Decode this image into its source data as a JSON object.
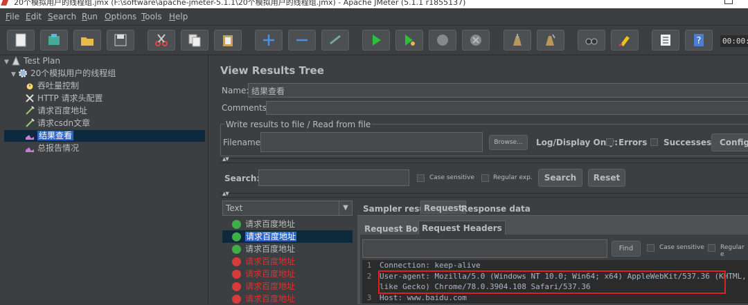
{
  "window": {
    "title": "20个模拟用户的线程组.jmx (F:\\software\\apache-jmeter-5.1.1\\20个模拟用户的线程组.jmx) - Apache JMeter (5.1.1 r1855137)"
  },
  "menu": [
    {
      "label": "File",
      "key": "F",
      "rest": "ile"
    },
    {
      "label": "Edit",
      "key": "E",
      "rest": "dit"
    },
    {
      "label": "Search",
      "key": "S",
      "rest": "earch"
    },
    {
      "label": "Run",
      "key": "R",
      "rest": "un"
    },
    {
      "label": "Options",
      "key": "O",
      "rest": "ptions"
    },
    {
      "label": "Tools",
      "key": "T",
      "rest": "ools"
    },
    {
      "label": "Help",
      "key": "H",
      "rest": "elp"
    }
  ],
  "toolbar": {
    "timer": "00:00:0",
    "icons": [
      "new-icon",
      "templates-icon",
      "open-icon",
      "save-icon",
      "cut-icon",
      "copy-icon",
      "paste-icon",
      "expand-icon",
      "collapse-icon",
      "toggle-icon",
      "start-icon",
      "start-no-pauses-icon",
      "stop-icon",
      "shutdown-icon",
      "clear-icon",
      "clear-all-icon",
      "search-icon",
      "reset-search-icon",
      "function-helper-icon",
      "help-icon"
    ]
  },
  "tree": [
    {
      "label": "Test Plan",
      "icon": "test-plan-icon",
      "level": 0,
      "arrow": "▼"
    },
    {
      "label": "20个模拟用户的线程组",
      "icon": "thread-group-icon",
      "level": 1,
      "arrow": "▼"
    },
    {
      "label": "吞吐量控制",
      "icon": "timer-icon",
      "level": 2,
      "arrow": ""
    },
    {
      "label": "HTTP 请求头配置",
      "icon": "config-icon",
      "level": 2,
      "arrow": ""
    },
    {
      "label": "请求百度地址",
      "icon": "sampler-icon",
      "level": 2,
      "arrow": ""
    },
    {
      "label": "请求csdn文章",
      "icon": "sampler-icon",
      "level": 2,
      "arrow": ""
    },
    {
      "label": "结果查看",
      "icon": "listener-icon",
      "level": 2,
      "arrow": "",
      "selected": true
    },
    {
      "label": "总报告情况",
      "icon": "listener-icon",
      "level": 2,
      "arrow": ""
    }
  ],
  "panel": {
    "title": "View Results Tree",
    "name_label": "Name:",
    "name_value": "结果查看",
    "comments_label": "Comments:",
    "write_group_title": "Write results to file / Read from file",
    "filename_label": "Filename",
    "browse_label": "Browse...",
    "log_display_label": "Log/Display Only:",
    "errors_label": "Errors",
    "successes_label": "Successes",
    "configure_label": "Configu",
    "search_label": "Search:",
    "case_sensitive_label": "Case sensitive",
    "regular_exp_label": "Regular exp.",
    "search_button": "Search",
    "reset_button": "Reset",
    "renderer_value": "Text"
  },
  "results": [
    {
      "label": "请求百度地址",
      "status": "success"
    },
    {
      "label": "请求百度地址",
      "status": "success",
      "selected": true
    },
    {
      "label": "请求百度地址",
      "status": "success"
    },
    {
      "label": "请求百度地址",
      "status": "error"
    },
    {
      "label": "请求百度地址",
      "status": "error"
    },
    {
      "label": "请求百度地址",
      "status": "error"
    },
    {
      "label": "请求百度地址",
      "status": "error"
    }
  ],
  "tabs": {
    "main": [
      "Sampler result",
      "Request",
      "Response data"
    ],
    "main_active": "Request",
    "sub": [
      "Request Body",
      "Request Headers"
    ],
    "sub_active": "Request Headers"
  },
  "detail": {
    "find_button": "Find",
    "case_sensitive_label": "Case sensitive",
    "regular_label": "Regular e"
  },
  "headers": [
    {
      "n": "1",
      "text": "Connection: keep-alive"
    },
    {
      "n": "2",
      "text": "User-agent: Mozilla/5.0 (Windows NT 10.0; Win64; x64) AppleWebKit/537.36 (KHTML,"
    },
    {
      "n": "",
      "text": "like Gecko) Chrome/78.0.3904.108 Safari/537.36"
    },
    {
      "n": "3",
      "text": "Host: www.baidu.com"
    }
  ],
  "colors": {
    "error_text": "#e03030",
    "success_icon": "#3fae49",
    "error_icon": "#d83b3b",
    "highlight_box": "#e02020",
    "selection": "#2f65ca"
  }
}
